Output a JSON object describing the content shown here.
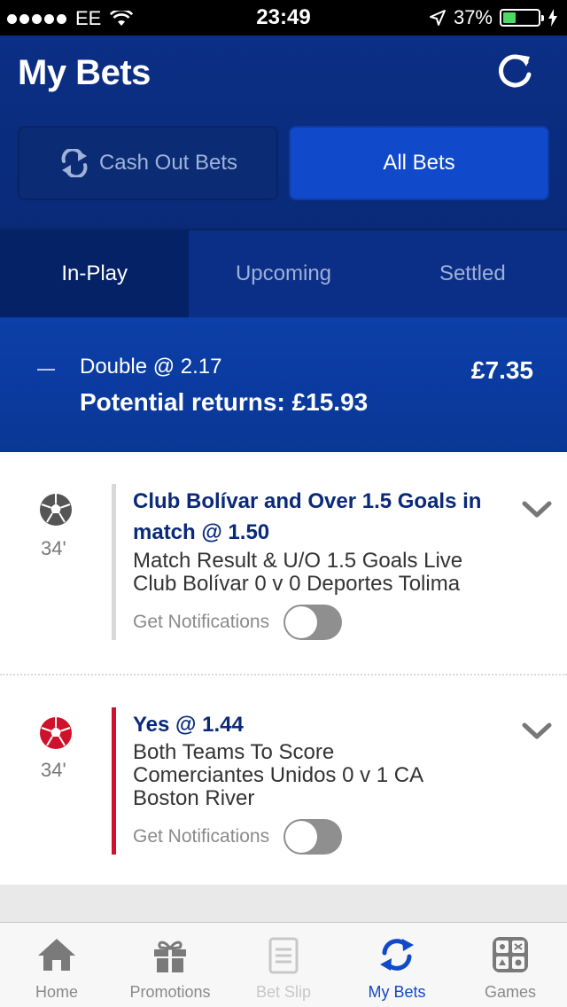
{
  "status_bar": {
    "carrier": "EE",
    "time": "23:49",
    "battery": "37%",
    "battery_level": 0.37
  },
  "header": {
    "title": "My Bets",
    "cash_out_label": "Cash Out Bets",
    "all_bets_label": "All Bets"
  },
  "tabs": [
    {
      "label": "In-Play"
    },
    {
      "label": "Upcoming"
    },
    {
      "label": "Settled"
    }
  ],
  "bet": {
    "type": "Double @ 2.17",
    "returns": "Potential returns: £15.93",
    "stake": "£7.35"
  },
  "selections": [
    {
      "heading": "Club Bolívar and Over 1.5 Goals in match @ 1.50",
      "market": "Match Result & U/O 1.5 Goals Live",
      "event": "Club Bolívar 0 v 0 Deportes Tolima",
      "minute": "34'",
      "notif_label": "Get Notifications",
      "ball_color": "#555555",
      "bar_color": "#d8d8d8"
    },
    {
      "heading": "Yes @ 1.44",
      "market": "Both Teams To Score",
      "event": "Comerciantes Unidos 0 v 1 CA Boston River",
      "minute": "34'",
      "notif_label": "Get Notifications",
      "ball_color": "#d0112b",
      "bar_color": "#d0112b"
    }
  ],
  "tabbar": [
    {
      "label": "Home",
      "icon": "home-icon"
    },
    {
      "label": "Promotions",
      "icon": "gift-icon"
    },
    {
      "label": "Bet Slip",
      "icon": "betslip-icon"
    },
    {
      "label": "My Bets",
      "icon": "mybets-icon"
    },
    {
      "label": "Games",
      "icon": "games-icon"
    }
  ],
  "colors": {
    "brand_dark": "#0b2f86",
    "brand_accent": "#1049c9",
    "live_red": "#d0112b"
  }
}
